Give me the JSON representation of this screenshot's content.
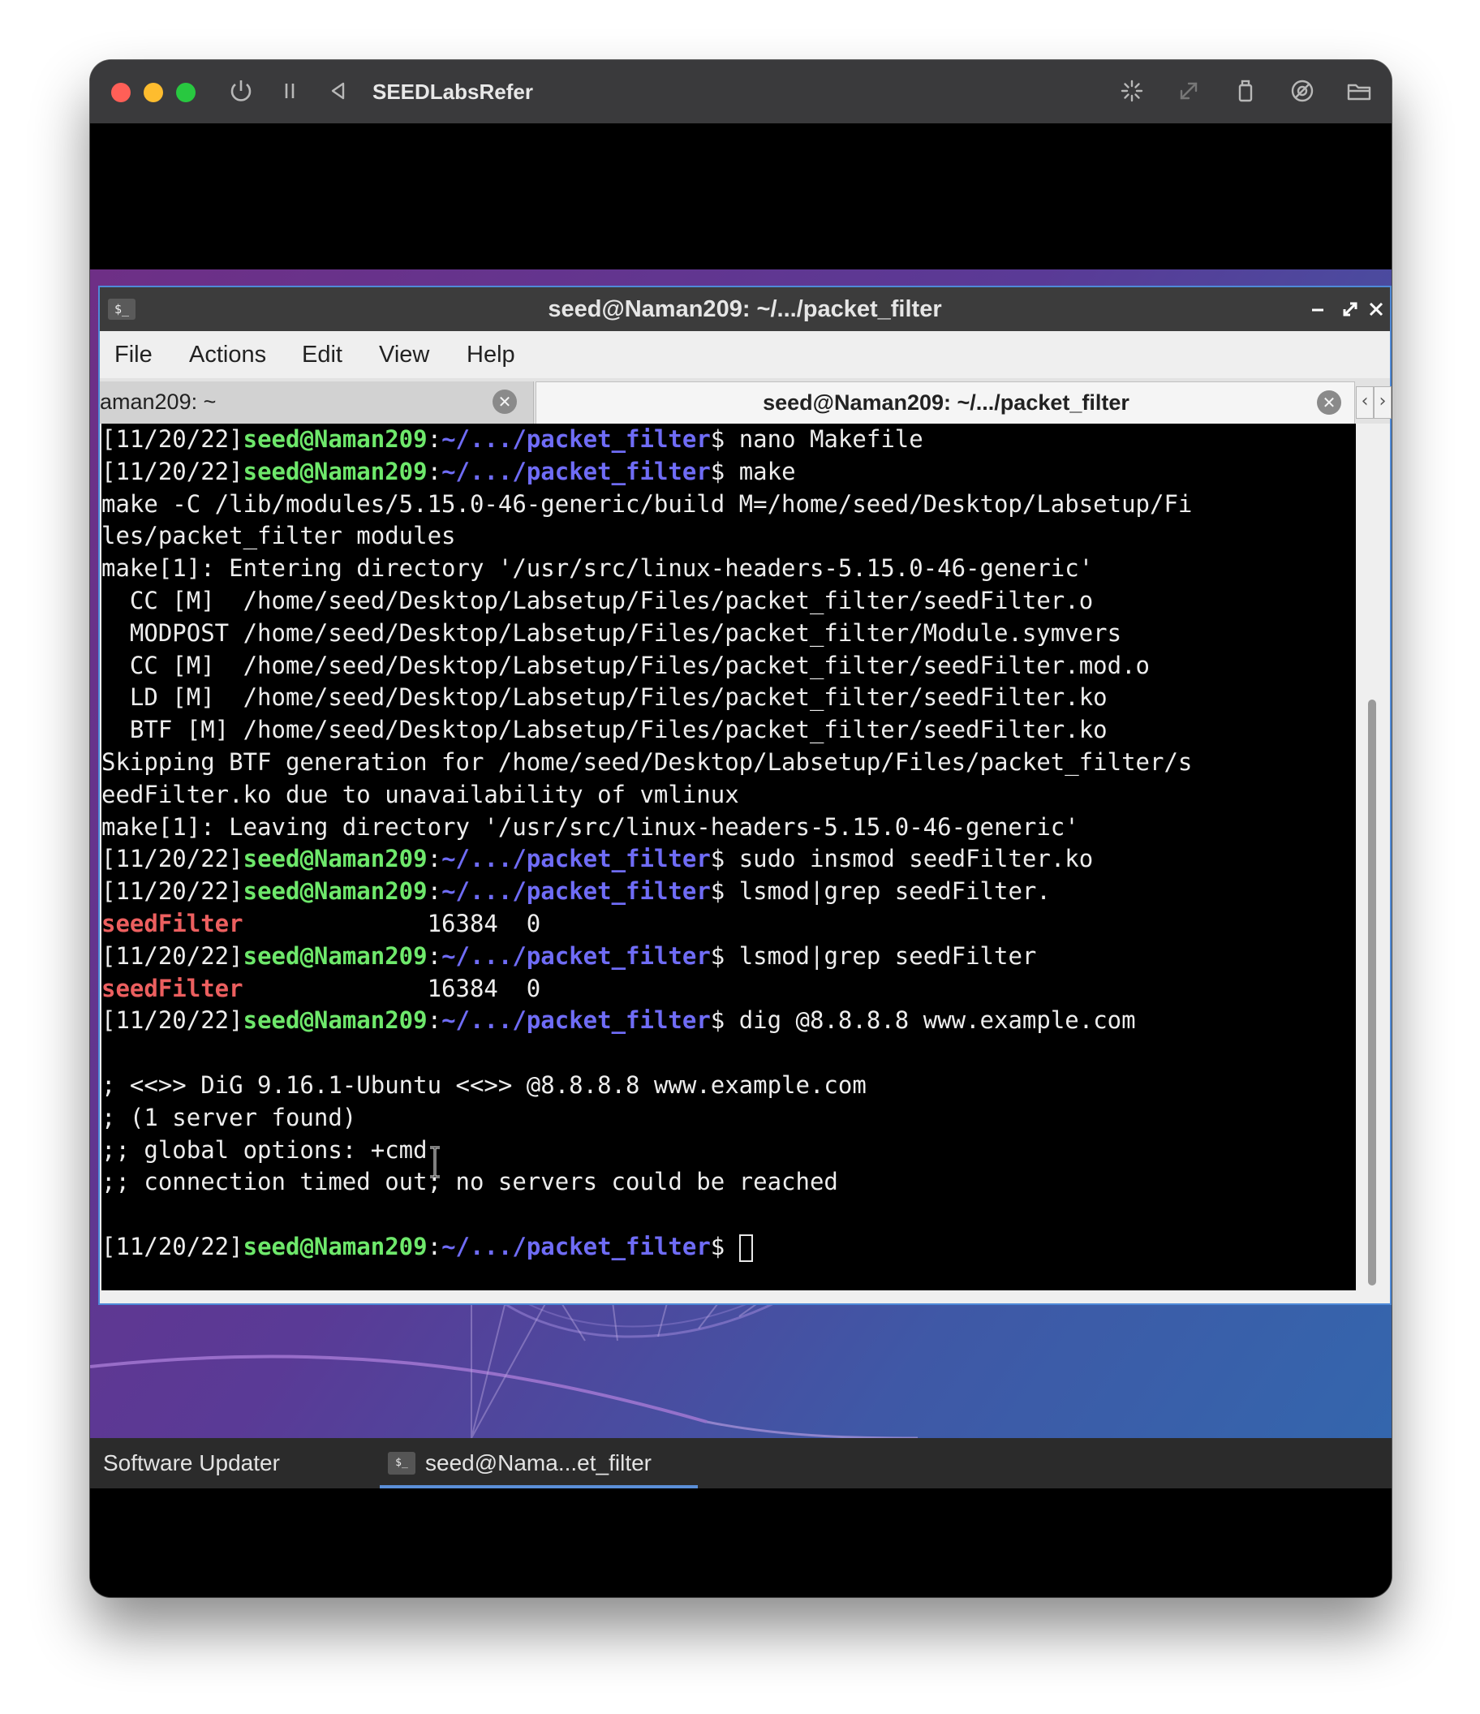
{
  "vm": {
    "title": "SEEDLabsRefer",
    "icons": [
      "power-icon",
      "pause-icon",
      "back-icon",
      "brightness-icon",
      "resize-icon",
      "usb-icon",
      "sound-icon",
      "shared-folder-icon"
    ]
  },
  "terminal": {
    "app_icon": "$_",
    "title": "seed@Naman209: ~/.../packet_filter",
    "menu": [
      "File",
      "Actions",
      "Edit",
      "View",
      "Help"
    ],
    "tabs": [
      {
        "label": "aman209: ~",
        "active": false
      },
      {
        "label": "seed@Naman209: ~/.../packet_filter",
        "active": true
      }
    ],
    "prompt": {
      "date": "[11/20/22]",
      "user": "seed@Naman209",
      "sep": ":",
      "path": "~/.../packet_filter",
      "symbol": "$ "
    },
    "lines": [
      {
        "type": "prompt",
        "cmd": "nano Makefile"
      },
      {
        "type": "prompt",
        "cmd": "make"
      },
      {
        "type": "out",
        "text": "make -C /lib/modules/5.15.0-46-generic/build M=/home/seed/Desktop/Labsetup/Fi"
      },
      {
        "type": "out",
        "text": "les/packet_filter modules"
      },
      {
        "type": "out",
        "text": "make[1]: Entering directory '/usr/src/linux-headers-5.15.0-46-generic'"
      },
      {
        "type": "out",
        "text": "  CC [M]  /home/seed/Desktop/Labsetup/Files/packet_filter/seedFilter.o"
      },
      {
        "type": "out",
        "text": "  MODPOST /home/seed/Desktop/Labsetup/Files/packet_filter/Module.symvers"
      },
      {
        "type": "out",
        "text": "  CC [M]  /home/seed/Desktop/Labsetup/Files/packet_filter/seedFilter.mod.o"
      },
      {
        "type": "out",
        "text": "  LD [M]  /home/seed/Desktop/Labsetup/Files/packet_filter/seedFilter.ko"
      },
      {
        "type": "out",
        "text": "  BTF [M] /home/seed/Desktop/Labsetup/Files/packet_filter/seedFilter.ko"
      },
      {
        "type": "out",
        "text": "Skipping BTF generation for /home/seed/Desktop/Labsetup/Files/packet_filter/s"
      },
      {
        "type": "out",
        "text": "eedFilter.ko due to unavailability of vmlinux"
      },
      {
        "type": "out",
        "text": "make[1]: Leaving directory '/usr/src/linux-headers-5.15.0-46-generic'"
      },
      {
        "type": "prompt",
        "cmd": "sudo insmod seedFilter.ko"
      },
      {
        "type": "prompt",
        "cmd": "lsmod|grep seedFilter."
      },
      {
        "type": "module",
        "name": "seedFilter",
        "rest": "             16384  0"
      },
      {
        "type": "prompt",
        "cmd": "lsmod|grep seedFilter"
      },
      {
        "type": "module",
        "name": "seedFilter",
        "rest": "             16384  0"
      },
      {
        "type": "prompt",
        "cmd": "dig @8.8.8.8 www.example.com"
      },
      {
        "type": "out",
        "text": ""
      },
      {
        "type": "out",
        "text": "; <<>> DiG 9.16.1-Ubuntu <<>> @8.8.8.8 www.example.com"
      },
      {
        "type": "out",
        "text": "; (1 server found)"
      },
      {
        "type": "out",
        "text": ";; global options: +cmd"
      },
      {
        "type": "out",
        "text": ";; connection timed out; no servers could be reached"
      },
      {
        "type": "out",
        "text": ""
      },
      {
        "type": "prompt",
        "cmd": "",
        "cursor": true
      }
    ]
  },
  "taskbar": {
    "items": [
      {
        "label": "Software Updater",
        "active": false
      },
      {
        "label": "seed@Nama...et_filter",
        "active": true
      }
    ]
  },
  "colors": {
    "prompt_user": "#6ee86b",
    "prompt_path": "#6f6cf6",
    "module_name": "#ec5f5f",
    "terminal_bg": "#000000",
    "focus_border": "#4f8ad8"
  }
}
